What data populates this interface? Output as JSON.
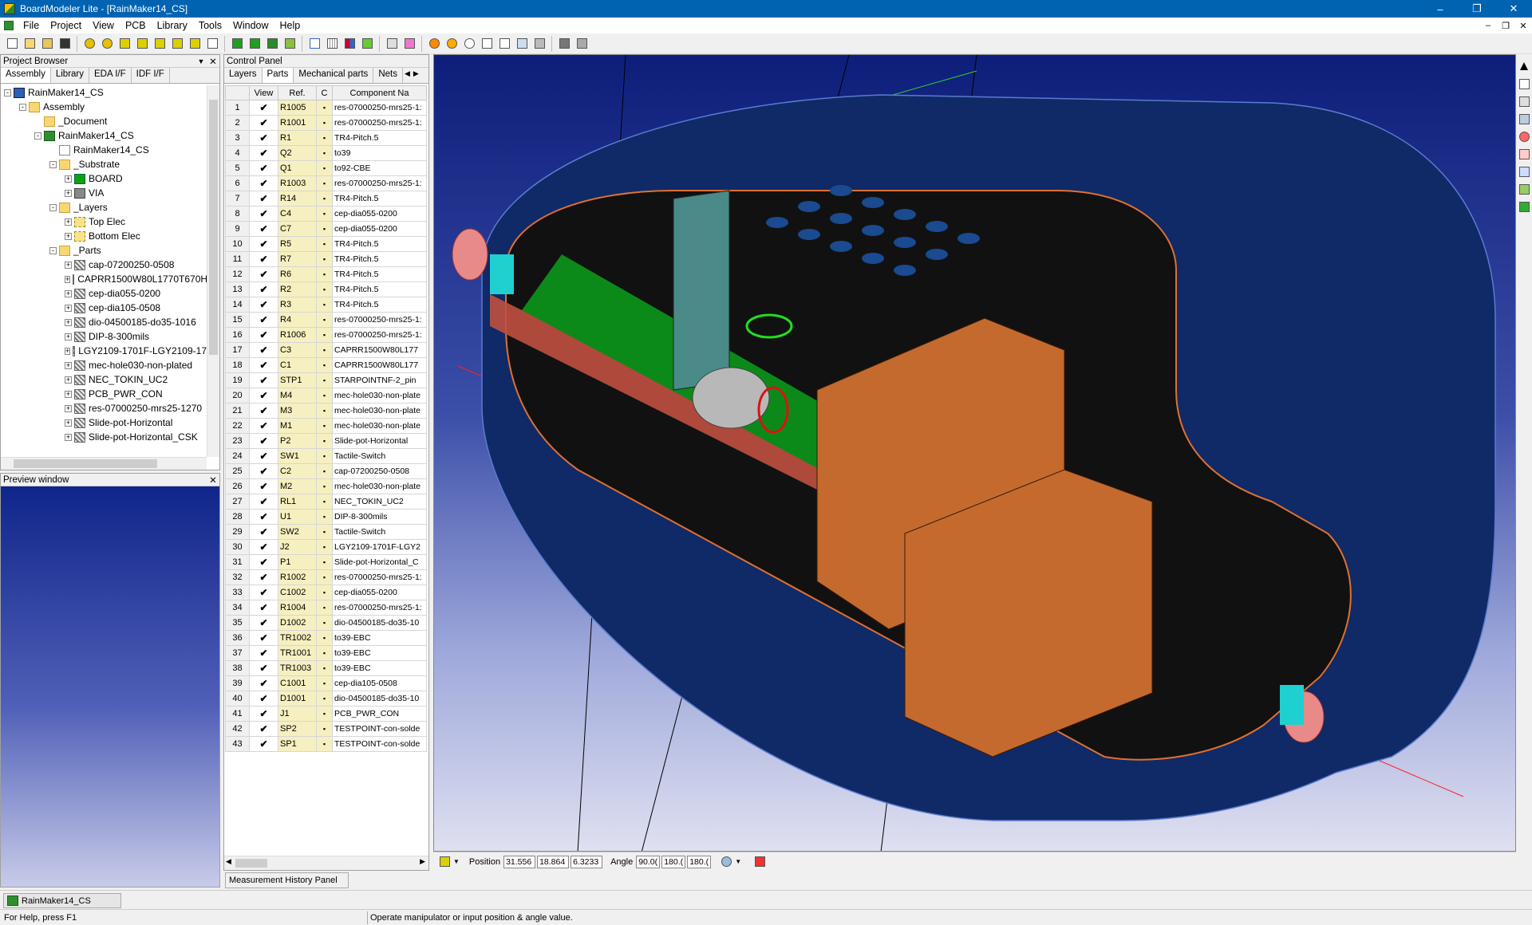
{
  "window": {
    "title": "BoardModeler Lite - [RainMaker14_CS]"
  },
  "menu": [
    "File",
    "Project",
    "View",
    "PCB",
    "Library",
    "Tools",
    "Window",
    "Help"
  ],
  "project_browser": {
    "title": "Project Browser",
    "tabs": [
      "Assembly",
      "Library",
      "EDA I/F",
      "IDF I/F"
    ],
    "tree": [
      {
        "level": 0,
        "exp": "-",
        "icon": "asm",
        "label": "RainMaker14_CS"
      },
      {
        "level": 1,
        "exp": "-",
        "icon": "folder",
        "label": "Assembly"
      },
      {
        "level": 2,
        "exp": "",
        "icon": "folder",
        "label": "_Document"
      },
      {
        "level": 2,
        "exp": "-",
        "icon": "chip",
        "label": "RainMaker14_CS"
      },
      {
        "level": 3,
        "exp": "",
        "icon": "doc",
        "label": "RainMaker14_CS"
      },
      {
        "level": 3,
        "exp": "-",
        "icon": "folder",
        "label": "_Substrate"
      },
      {
        "level": 4,
        "exp": "+",
        "icon": "board",
        "label": "BOARD"
      },
      {
        "level": 4,
        "exp": "+",
        "icon": "via",
        "label": "VIA"
      },
      {
        "level": 3,
        "exp": "-",
        "icon": "folder",
        "label": "_Layers"
      },
      {
        "level": 4,
        "exp": "+",
        "icon": "layer",
        "label": "Top Elec"
      },
      {
        "level": 4,
        "exp": "+",
        "icon": "layer",
        "label": "Bottom Elec"
      },
      {
        "level": 3,
        "exp": "-",
        "icon": "folder",
        "label": "_Parts"
      },
      {
        "level": 4,
        "exp": "+",
        "icon": "part",
        "label": "cap-07200250-0508"
      },
      {
        "level": 4,
        "exp": "+",
        "icon": "part",
        "label": "CAPRR1500W80L1770T670H"
      },
      {
        "level": 4,
        "exp": "+",
        "icon": "part",
        "label": "cep-dia055-0200"
      },
      {
        "level": 4,
        "exp": "+",
        "icon": "part",
        "label": "cep-dia105-0508"
      },
      {
        "level": 4,
        "exp": "+",
        "icon": "part",
        "label": "dio-04500185-do35-1016"
      },
      {
        "level": 4,
        "exp": "+",
        "icon": "part",
        "label": "DIP-8-300mils"
      },
      {
        "level": 4,
        "exp": "+",
        "icon": "part",
        "label": "LGY2109-1701F-LGY2109-17"
      },
      {
        "level": 4,
        "exp": "+",
        "icon": "part",
        "label": "mec-hole030-non-plated"
      },
      {
        "level": 4,
        "exp": "+",
        "icon": "part",
        "label": "NEC_TOKIN_UC2"
      },
      {
        "level": 4,
        "exp": "+",
        "icon": "part",
        "label": "PCB_PWR_CON"
      },
      {
        "level": 4,
        "exp": "+",
        "icon": "part",
        "label": "res-07000250-mrs25-1270"
      },
      {
        "level": 4,
        "exp": "+",
        "icon": "part",
        "label": "Slide-pot-Horizontal"
      },
      {
        "level": 4,
        "exp": "+",
        "icon": "part",
        "label": "Slide-pot-Horizontal_CSK"
      }
    ]
  },
  "preview": {
    "title": "Preview window"
  },
  "control_panel": {
    "title": "Control Panel",
    "tabs": [
      "Layers",
      "Parts",
      "Mechanical parts",
      "Nets"
    ],
    "columns": [
      "",
      "View",
      "Ref.",
      "C",
      "Component Na"
    ],
    "rows": [
      [
        "1",
        "R1005",
        "res-07000250-mrs25-1:"
      ],
      [
        "2",
        "R1001",
        "res-07000250-mrs25-1:"
      ],
      [
        "3",
        "R1",
        "TR4-Pitch.5"
      ],
      [
        "4",
        "Q2",
        "to39"
      ],
      [
        "5",
        "Q1",
        "to92-CBE"
      ],
      [
        "6",
        "R1003",
        "res-07000250-mrs25-1:"
      ],
      [
        "7",
        "R14",
        "TR4-Pitch.5"
      ],
      [
        "8",
        "C4",
        "cep-dia055-0200"
      ],
      [
        "9",
        "C7",
        "cep-dia055-0200"
      ],
      [
        "10",
        "R5",
        "TR4-Pitch.5"
      ],
      [
        "11",
        "R7",
        "TR4-Pitch.5"
      ],
      [
        "12",
        "R6",
        "TR4-Pitch.5"
      ],
      [
        "13",
        "R2",
        "TR4-Pitch.5"
      ],
      [
        "14",
        "R3",
        "TR4-Pitch.5"
      ],
      [
        "15",
        "R4",
        "res-07000250-mrs25-1:"
      ],
      [
        "16",
        "R1006",
        "res-07000250-mrs25-1:"
      ],
      [
        "17",
        "C3",
        "CAPRR1500W80L177"
      ],
      [
        "18",
        "C1",
        "CAPRR1500W80L177"
      ],
      [
        "19",
        "STP1",
        "STARPOINTNF-2_pin"
      ],
      [
        "20",
        "M4",
        "mec-hole030-non-plate"
      ],
      [
        "21",
        "M3",
        "mec-hole030-non-plate"
      ],
      [
        "22",
        "M1",
        "mec-hole030-non-plate"
      ],
      [
        "23",
        "P2",
        "Slide-pot-Horizontal"
      ],
      [
        "24",
        "SW1",
        "Tactile-Switch"
      ],
      [
        "25",
        "C2",
        "cap-07200250-0508"
      ],
      [
        "26",
        "M2",
        "mec-hole030-non-plate"
      ],
      [
        "27",
        "RL1",
        "NEC_TOKIN_UC2"
      ],
      [
        "28",
        "U1",
        "DIP-8-300mils"
      ],
      [
        "29",
        "SW2",
        "Tactile-Switch"
      ],
      [
        "30",
        "J2",
        "LGY2109-1701F-LGY2"
      ],
      [
        "31",
        "P1",
        "Slide-pot-Horizontal_C"
      ],
      [
        "32",
        "R1002",
        "res-07000250-mrs25-1:"
      ],
      [
        "33",
        "C1002",
        "cep-dia055-0200"
      ],
      [
        "34",
        "R1004",
        "res-07000250-mrs25-1:"
      ],
      [
        "35",
        "D1002",
        "dio-04500185-do35-10"
      ],
      [
        "36",
        "TR1002",
        "to39-EBC"
      ],
      [
        "37",
        "TR1001",
        "to39-EBC"
      ],
      [
        "38",
        "TR1003",
        "to39-EBC"
      ],
      [
        "39",
        "C1001",
        "cep-dia105-0508"
      ],
      [
        "40",
        "D1001",
        "dio-04500185-do35-10"
      ],
      [
        "41",
        "J1",
        "PCB_PWR_CON"
      ],
      [
        "42",
        "SP2",
        "TESTPOINT-con-solde"
      ],
      [
        "43",
        "SP1",
        "TESTPOINT-con-solde"
      ]
    ]
  },
  "viewport_status": {
    "position_label": "Position",
    "position": [
      "31.556",
      "18.864",
      "6.3233"
    ],
    "angle_label": "Angle",
    "angle": [
      "90.0(",
      "180.(",
      "180.("
    ]
  },
  "measurement_tab": "Measurement History Panel",
  "document_tab": "RainMaker14_CS",
  "status": {
    "left": "For Help, press F1",
    "right": "Operate manipulator or input position & angle value."
  }
}
